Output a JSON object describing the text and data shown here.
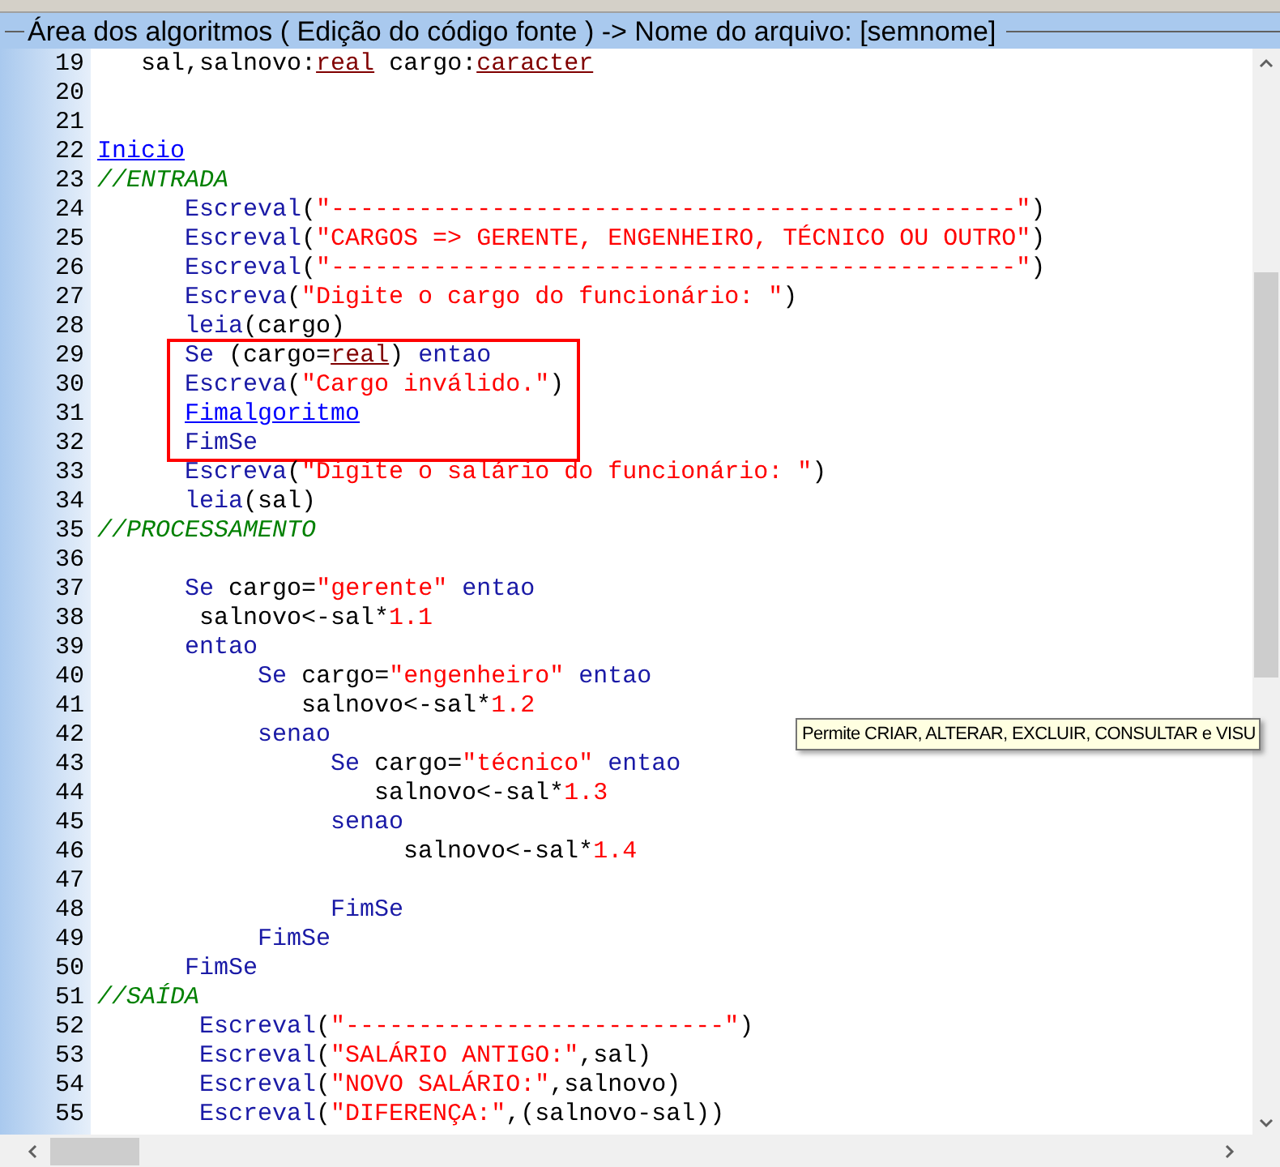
{
  "panel": {
    "title": "Área dos algoritmos ( Edição do código fonte ) -> Nome do arquivo: [semnome]"
  },
  "editor": {
    "lines": [
      {
        "number": "19",
        "highlighted": false,
        "tokens": [
          {
            "kind": "plain",
            "text": "   sal,salnovo:"
          },
          {
            "kind": "type",
            "text": "real"
          },
          {
            "kind": "plain",
            "text": " cargo:"
          },
          {
            "kind": "type",
            "text": "caracter"
          }
        ]
      },
      {
        "number": "20",
        "highlighted": false
      },
      {
        "number": "21",
        "highlighted": false
      },
      {
        "number": "22",
        "highlighted": false,
        "tokens": [
          {
            "kind": "link",
            "text": "Inicio"
          }
        ]
      },
      {
        "number": "23",
        "highlighted": false,
        "tokens": [
          {
            "kind": "comment",
            "text": "//ENTRADA"
          }
        ]
      },
      {
        "number": "24",
        "highlighted": false,
        "tokens": [
          {
            "kind": "keyword",
            "text": "      Escreval"
          },
          {
            "kind": "plain",
            "text": "("
          },
          {
            "kind": "string",
            "text": "\"-----------------------------------------------\""
          },
          {
            "kind": "plain",
            "text": ")"
          }
        ]
      },
      {
        "number": "25",
        "highlighted": false,
        "tokens": [
          {
            "kind": "keyword",
            "text": "      Escreval"
          },
          {
            "kind": "plain",
            "text": "("
          },
          {
            "kind": "string",
            "text": "\"CARGOS => GERENTE, ENGENHEIRO, TÉCNICO OU OUTRO\""
          },
          {
            "kind": "plain",
            "text": ")"
          }
        ]
      },
      {
        "number": "26",
        "highlighted": false,
        "tokens": [
          {
            "kind": "keyword",
            "text": "      Escreval"
          },
          {
            "kind": "plain",
            "text": "("
          },
          {
            "kind": "string",
            "text": "\"-----------------------------------------------\""
          },
          {
            "kind": "plain",
            "text": ")"
          }
        ]
      },
      {
        "number": "27",
        "highlighted": false,
        "tokens": [
          {
            "kind": "keyword",
            "text": "      Escreva"
          },
          {
            "kind": "plain",
            "text": "("
          },
          {
            "kind": "string",
            "text": "\"Digite o cargo do funcionário: \""
          },
          {
            "kind": "plain",
            "text": ")"
          }
        ]
      },
      {
        "number": "28",
        "highlighted": false,
        "tokens": [
          {
            "kind": "keyword",
            "text": "      leia"
          },
          {
            "kind": "plain",
            "text": "(cargo)"
          }
        ]
      },
      {
        "number": "29",
        "highlighted": true,
        "tokens": [
          {
            "kind": "keyword",
            "text": "      Se"
          },
          {
            "kind": "plain",
            "text": " (cargo="
          },
          {
            "kind": "type",
            "text": "real"
          },
          {
            "kind": "plain",
            "text": ")"
          },
          {
            "kind": "keyword",
            "text": " entao"
          }
        ]
      },
      {
        "number": "30",
        "highlighted": true,
        "tokens": [
          {
            "kind": "keyword",
            "text": "      Escreva"
          },
          {
            "kind": "plain",
            "text": "("
          },
          {
            "kind": "string",
            "text": "\"Cargo inválido.\""
          },
          {
            "kind": "plain",
            "text": ")"
          }
        ]
      },
      {
        "number": "31",
        "highlighted": true,
        "tokens": [
          {
            "kind": "link",
            "text": "      Fimalgoritmo"
          }
        ]
      },
      {
        "number": "32",
        "highlighted": true,
        "tokens": [
          {
            "kind": "keyword",
            "text": "      FimSe"
          }
        ]
      },
      {
        "number": "33",
        "highlighted": false,
        "tokens": [
          {
            "kind": "keyword",
            "text": "      Escreva"
          },
          {
            "kind": "plain",
            "text": "("
          },
          {
            "kind": "string",
            "text": "\"Digite o salário do funcionário: \""
          },
          {
            "kind": "plain",
            "text": ")"
          }
        ]
      },
      {
        "number": "34",
        "highlighted": false,
        "tokens": [
          {
            "kind": "keyword",
            "text": "      leia"
          },
          {
            "kind": "plain",
            "text": "(sal)"
          }
        ]
      },
      {
        "number": "35",
        "highlighted": false,
        "tokens": [
          {
            "kind": "comment",
            "text": "//PROCESSAMENTO"
          }
        ]
      },
      {
        "number": "36",
        "highlighted": false
      },
      {
        "number": "37",
        "highlighted": false,
        "tokens": [
          {
            "kind": "keyword",
            "text": "      Se"
          },
          {
            "kind": "plain",
            "text": " cargo="
          },
          {
            "kind": "string",
            "text": "\"gerente\""
          },
          {
            "kind": "keyword",
            "text": " entao"
          }
        ]
      },
      {
        "number": "38",
        "highlighted": false,
        "tokens": [
          {
            "kind": "plain",
            "text": "       salnovo<-sal*"
          },
          {
            "kind": "number",
            "text": "1.1"
          }
        ]
      },
      {
        "number": "39",
        "highlighted": false,
        "tokens": [
          {
            "kind": "keyword",
            "text": "      entao"
          }
        ]
      },
      {
        "number": "40",
        "highlighted": false,
        "tokens": [
          {
            "kind": "keyword",
            "text": "           Se"
          },
          {
            "kind": "plain",
            "text": " cargo="
          },
          {
            "kind": "string",
            "text": "\"engenheiro\""
          },
          {
            "kind": "keyword",
            "text": " entao"
          }
        ]
      },
      {
        "number": "41",
        "highlighted": false,
        "tokens": [
          {
            "kind": "plain",
            "text": "              salnovo<-sal*"
          },
          {
            "kind": "number",
            "text": "1.2"
          }
        ]
      },
      {
        "number": "42",
        "highlighted": false,
        "tokens": [
          {
            "kind": "keyword",
            "text": "           senao"
          }
        ]
      },
      {
        "number": "43",
        "highlighted": false,
        "tokens": [
          {
            "kind": "keyword",
            "text": "                Se"
          },
          {
            "kind": "plain",
            "text": " cargo="
          },
          {
            "kind": "string",
            "text": "\"técnico\""
          },
          {
            "kind": "keyword",
            "text": " entao"
          }
        ]
      },
      {
        "number": "44",
        "highlighted": false,
        "tokens": [
          {
            "kind": "plain",
            "text": "                   salnovo<-sal*"
          },
          {
            "kind": "number",
            "text": "1.3"
          }
        ]
      },
      {
        "number": "45",
        "highlighted": false,
        "tokens": [
          {
            "kind": "keyword",
            "text": "                senao"
          }
        ]
      },
      {
        "number": "46",
        "highlighted": false,
        "tokens": [
          {
            "kind": "plain",
            "text": "                     salnovo<-sal*"
          },
          {
            "kind": "number",
            "text": "1.4"
          }
        ]
      },
      {
        "number": "47",
        "highlighted": false
      },
      {
        "number": "48",
        "highlighted": false,
        "tokens": [
          {
            "kind": "keyword",
            "text": "                FimSe"
          }
        ]
      },
      {
        "number": "49",
        "highlighted": false,
        "tokens": [
          {
            "kind": "keyword",
            "text": "           FimSe"
          }
        ]
      },
      {
        "number": "50",
        "highlighted": false,
        "tokens": [
          {
            "kind": "keyword",
            "text": "      FimSe"
          }
        ]
      },
      {
        "number": "51",
        "highlighted": false,
        "tokens": [
          {
            "kind": "comment",
            "text": "//SAÍDA"
          }
        ]
      },
      {
        "number": "52",
        "highlighted": false,
        "tokens": [
          {
            "kind": "keyword",
            "text": "       Escreval"
          },
          {
            "kind": "plain",
            "text": "("
          },
          {
            "kind": "string",
            "text": "\"--------------------------\""
          },
          {
            "kind": "plain",
            "text": ")"
          }
        ]
      },
      {
        "number": "53",
        "highlighted": false,
        "tokens": [
          {
            "kind": "keyword",
            "text": "       Escreval"
          },
          {
            "kind": "plain",
            "text": "("
          },
          {
            "kind": "string",
            "text": "\"SALÁRIO ANTIGO:\""
          },
          {
            "kind": "plain",
            "text": ",sal)"
          }
        ]
      },
      {
        "number": "54",
        "highlighted": false,
        "tokens": [
          {
            "kind": "keyword",
            "text": "       Escreval"
          },
          {
            "kind": "plain",
            "text": "("
          },
          {
            "kind": "string",
            "text": "\"NOVO SALÁRIO:\""
          },
          {
            "kind": "plain",
            "text": ",salnovo)"
          }
        ]
      },
      {
        "number": "55",
        "highlighted": false,
        "tokens": [
          {
            "kind": "keyword",
            "text": "       Escreval"
          },
          {
            "kind": "plain",
            "text": "("
          },
          {
            "kind": "string",
            "text": "\"DIFERENÇA:\""
          },
          {
            "kind": "plain",
            "text": ",(salnovo-sal))"
          }
        ]
      }
    ]
  },
  "tooltip": {
    "text": "Permite CRIAR, ALTERAR, EXCLUIR, CONSULTAR e VISU"
  }
}
